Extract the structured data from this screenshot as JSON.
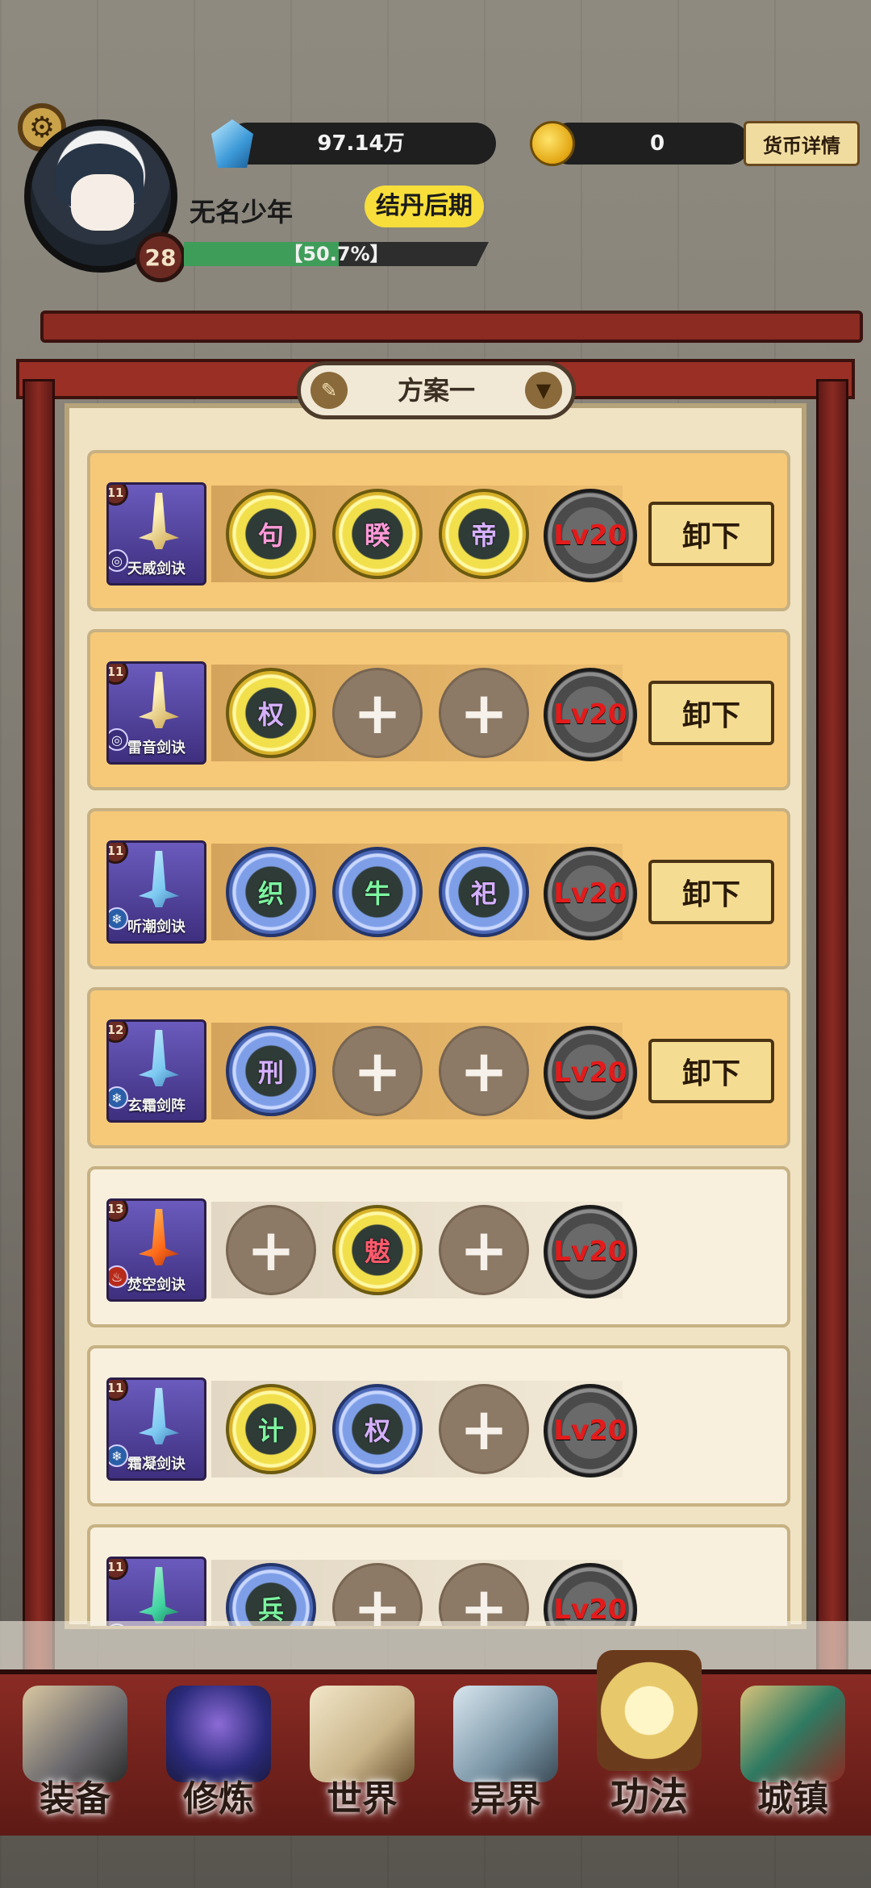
{
  "player": {
    "name": "无名少年",
    "level": "28",
    "realm": "结丹后期",
    "xp_text": "【50.7%】",
    "xp_progress": 0.507
  },
  "resources": {
    "crystal_value": "97.14万",
    "coin_value": "0",
    "currency_detail_label": "货币详情"
  },
  "plan": {
    "label": "方案一"
  },
  "skills": [
    {
      "name": "天威剑诀",
      "level": "11",
      "element": "wind",
      "equipped": true,
      "slots": [
        {
          "type": "gold",
          "glyph": "句",
          "color": "pink"
        },
        {
          "type": "gold",
          "glyph": "睽",
          "color": "pink"
        },
        {
          "type": "gold",
          "glyph": "帝",
          "color": "purple"
        }
      ],
      "lv_label": "Lv20",
      "unload_label": "卸下"
    },
    {
      "name": "雷音剑诀",
      "level": "11",
      "element": "wind",
      "equipped": true,
      "slots": [
        {
          "type": "gold",
          "glyph": "权",
          "color": "purple"
        },
        {
          "type": "empty"
        },
        {
          "type": "empty"
        }
      ],
      "lv_label": "Lv20",
      "unload_label": "卸下"
    },
    {
      "name": "听潮剑诀",
      "level": "11",
      "element": "ice",
      "equipped": true,
      "slots": [
        {
          "type": "blue",
          "glyph": "织",
          "color": "green"
        },
        {
          "type": "blue",
          "glyph": "牛",
          "color": "green"
        },
        {
          "type": "blue",
          "glyph": "祀",
          "color": "purple"
        }
      ],
      "lv_label": "Lv20",
      "unload_label": "卸下"
    },
    {
      "name": "玄霜剑阵",
      "level": "12",
      "element": "ice",
      "equipped": true,
      "slots": [
        {
          "type": "blue",
          "glyph": "刑",
          "color": "purple"
        },
        {
          "type": "empty"
        },
        {
          "type": "empty"
        }
      ],
      "lv_label": "Lv20",
      "unload_label": "卸下"
    },
    {
      "name": "焚空剑诀",
      "level": "13",
      "element": "fire",
      "equipped": false,
      "slots": [
        {
          "type": "empty"
        },
        {
          "type": "gold",
          "glyph": "魃",
          "color": "red"
        },
        {
          "type": "empty"
        }
      ],
      "lv_label": "Lv20",
      "unload_label": ""
    },
    {
      "name": "霜凝剑诀",
      "level": "11",
      "element": "ice",
      "equipped": false,
      "slots": [
        {
          "type": "gold",
          "glyph": "计",
          "color": "green"
        },
        {
          "type": "blue",
          "glyph": "权",
          "color": "purple"
        },
        {
          "type": "empty"
        }
      ],
      "lv_label": "Lv20",
      "unload_label": ""
    },
    {
      "name": "",
      "level": "11",
      "element": "ice",
      "equipped": false,
      "slots": [
        {
          "type": "blue",
          "glyph": "兵",
          "color": "green"
        },
        {
          "type": "empty"
        },
        {
          "type": "empty"
        }
      ],
      "lv_label": "Lv20",
      "unload_label": ""
    }
  ],
  "nav": {
    "items": [
      {
        "label": "装备",
        "icon": "armor-icon"
      },
      {
        "label": "修炼",
        "icon": "cultivator-icon"
      },
      {
        "label": "世界",
        "icon": "scroll-map-icon"
      },
      {
        "label": "异界",
        "icon": "mountain-icon"
      },
      {
        "label": "功法",
        "icon": "books-icon",
        "active": true
      },
      {
        "label": "城镇",
        "icon": "gate-icon"
      }
    ]
  },
  "colors": {
    "frame_red": "#8b2b22",
    "equipped_row": "#f6c978",
    "unequipped_row": "#f8f0dd",
    "lv_text": "#e31b1b"
  }
}
